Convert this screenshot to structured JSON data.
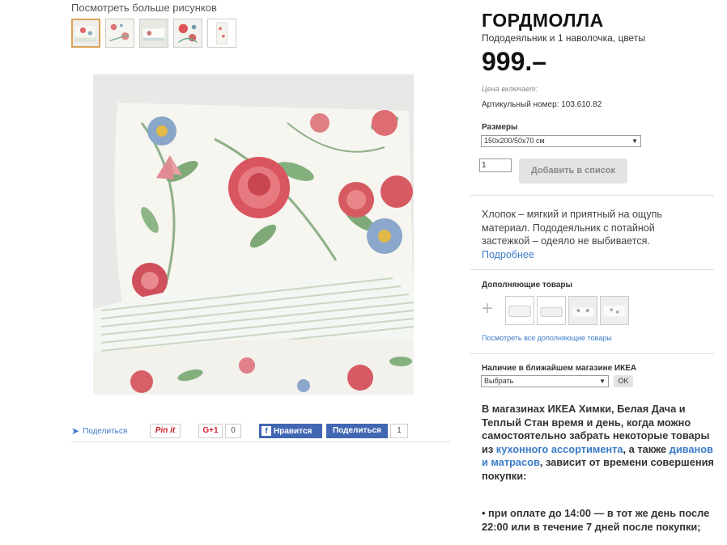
{
  "gallery": {
    "more_label": "Посмотреть больше рисунков"
  },
  "share": {
    "share_label": "Поделиться",
    "pin_label": "Pin it",
    "gplus_label": "G+1",
    "gplus_count": "0",
    "fb_like_label": "Нравится",
    "fb_share_label": "Поделиться",
    "fb_count": "1"
  },
  "product": {
    "name": "ГОРДМОЛЛА",
    "subtitle": "Пододеяльник и 1 наволочка, цветы",
    "price": "999.–",
    "price_includes": "Цена включает:",
    "article": "Артикульный номер: 103.610.82",
    "sizes_label": "Размеры",
    "size_selected": "150x200/50x70 см",
    "quantity": "1",
    "add_button": "Добавить в список"
  },
  "description": {
    "text": "Хлопок – мягкий и приятный на ощупь материал. Пододеяльник с потайной застежкой – одеяло не выбивается.",
    "more_link": "Подробнее"
  },
  "complementary": {
    "label": "Дополняющие товары",
    "see_all_link": "Посмотреть все дополняющие товары"
  },
  "store": {
    "label": "Наличие в ближайшем магазине ИКЕА",
    "select_value": "Выбрать",
    "ok_button": "OK",
    "text_part1": "В магазинах ИКЕА Химки, Белая Дача и Теплый Стан время и день, когда можно самостоятельно забрать некоторые товары из ",
    "link_kitchen": "кухонного ассортимента",
    "text_part2": ", а также ",
    "link_sofas": "диванов и матрасов",
    "text_part3": ", зависит от времени совершения покупки:",
    "bullet": "• при оплате до 14:00 — в тот же день после 22:00 или в течение 7 дней после покупки;"
  },
  "colors": {
    "link": "#3a7bc8",
    "facebook": "#4267b2",
    "pinterest": "#cb2027"
  }
}
